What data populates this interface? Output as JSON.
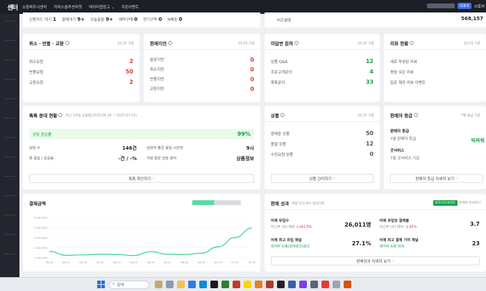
{
  "topbar": {
    "brand": "센터",
    "nav": [
      "쇼핑파트너센터",
      "커머스솔루션마켓",
      "데이터랩광고 ⌄",
      "쿠폰이벤트"
    ],
    "badge": "대표자",
    "right_link": "스토어"
  },
  "strip": {
    "items": [
      {
        "label": "신용카드 대기",
        "value": "1"
      },
      {
        "label": "결제대기",
        "value": "9+"
      },
      {
        "label": "오늘출발",
        "value": "9+"
      },
      {
        "label": "예약구매",
        "value": "0"
      },
      {
        "label": "정기구독",
        "value": "0"
      },
      {
        "label": "N배송",
        "value": "0"
      }
    ],
    "right_label": "비즈월렛",
    "right_value": "568,157"
  },
  "cards": {
    "cancel": {
      "title": "취소 · 반품 · 교환",
      "stamp": "10:25 기준",
      "rows": [
        {
          "label": "취소요청",
          "value": "2"
        },
        {
          "label": "반품요청",
          "value": "50"
        },
        {
          "label": "교환요청",
          "value": "2"
        }
      ]
    },
    "stop": {
      "title": "판매지연",
      "stamp": "10:25 기준",
      "rows": [
        {
          "label": "발송지연",
          "value": "0"
        },
        {
          "label": "취소지연",
          "value": "0"
        },
        {
          "label": "반품지연",
          "value": "0"
        },
        {
          "label": "교환지연",
          "value": "0"
        }
      ]
    },
    "inquiry": {
      "title": "미답변 문의",
      "stamp": "10:25 기준",
      "rows": [
        {
          "label": "상품 Q&A",
          "value": "12"
        },
        {
          "label": "주문고객문의",
          "value": "4"
        },
        {
          "label": "톡톡문의",
          "value": "33"
        }
      ]
    },
    "review": {
      "title": "리뷰 현황",
      "stamp": "10:25 기준",
      "rows": [
        {
          "label": "새로 작성된 리뷰"
        },
        {
          "label": "평점 낮은 리뷰"
        },
        {
          "label": "일로 제공 리뷰 이벤트"
        }
      ]
    },
    "talk": {
      "title": "톡톡 응대 현황",
      "stamp": "최근 1주일 응답률(2025.06.26 ~ 2025.07.02)",
      "progress_label": "상담 응답률",
      "progress_value": "99%",
      "metrics": [
        {
          "label": "상담 수",
          "value": "146건"
        },
        {
          "label": "상담자 평균 응답 시간대",
          "value": "9시"
        },
        {
          "label": "봇 응답 / 성공률",
          "value": "-건 / -%"
        },
        {
          "label": "가장 많은 상담 분야",
          "value": "상품정보"
        }
      ],
      "button": "톡톡 확인하기"
    },
    "product": {
      "title": "상품",
      "stamp": "10:25 기준",
      "rows": [
        {
          "label": "판매중 상품",
          "value": "50"
        },
        {
          "label": "품절 상품",
          "value": "12"
        },
        {
          "label": "수정요청 상품",
          "value": "0"
        }
      ],
      "button": "상품 관리하기"
    },
    "grade": {
      "title": "판매자 등급",
      "stamp": "7월 등급 기준",
      "grade_title": "판매자 등급",
      "grade_sub": "7월 판매자 등급",
      "grade_value": "빅파워",
      "good_title": "굿서비스",
      "good_sub": "7월 굿서비스 기준",
      "good_value": "",
      "button": "판매자 등급 자세히 보기"
    },
    "sales": {
      "title": "결제금액"
    },
    "perf": {
      "title": "판매 성과",
      "stamp": "매일 오전 8시 업데이트",
      "tag": "비즈어드바이저",
      "tag_sub": "판매자 분석하기",
      "cells": [
        {
          "title": "어제 유입수",
          "sub_prefix": "지난주 (수) 대비",
          "sub_change": "+161.5%",
          "value": "26,011명"
        },
        {
          "title": "어제 유입당 결제율",
          "sub_prefix": "지난주 (수) 대비",
          "sub_change": "-1.65%",
          "value": "3.7"
        },
        {
          "title": "어제 최고 유입 채널",
          "link": "네이버 쇼핑(검색광고)광고",
          "value": "27.1%"
        },
        {
          "title": "어제 최고 결제 기여 채널",
          "link": "네이버 쇼핑 검색",
          "value": "23"
        }
      ],
      "button": "판매성과 자세히 보기"
    }
  },
  "chart_data": {
    "type": "line",
    "title": "결제금액",
    "x": [
      "06.20",
      "06.21",
      "06.22",
      "06.23",
      "06.24",
      "06.25",
      "06.26",
      "06.27",
      "06.28",
      "06.29",
      "06.30",
      "07.01",
      "07.02"
    ],
    "y_ticks": [
      "3,000,000",
      "2,500,000",
      "2,000,000",
      "1,500,000",
      "1,000,000"
    ],
    "values": [
      900000,
      650000,
      680000,
      720000,
      700000,
      640000,
      880000,
      720000,
      700000,
      780000,
      1180000,
      1760000,
      2350000
    ],
    "ylim": [
      500000,
      3000000
    ],
    "color": "#2ed48a",
    "grid": true
  },
  "taskbar": {
    "search": "검색"
  }
}
